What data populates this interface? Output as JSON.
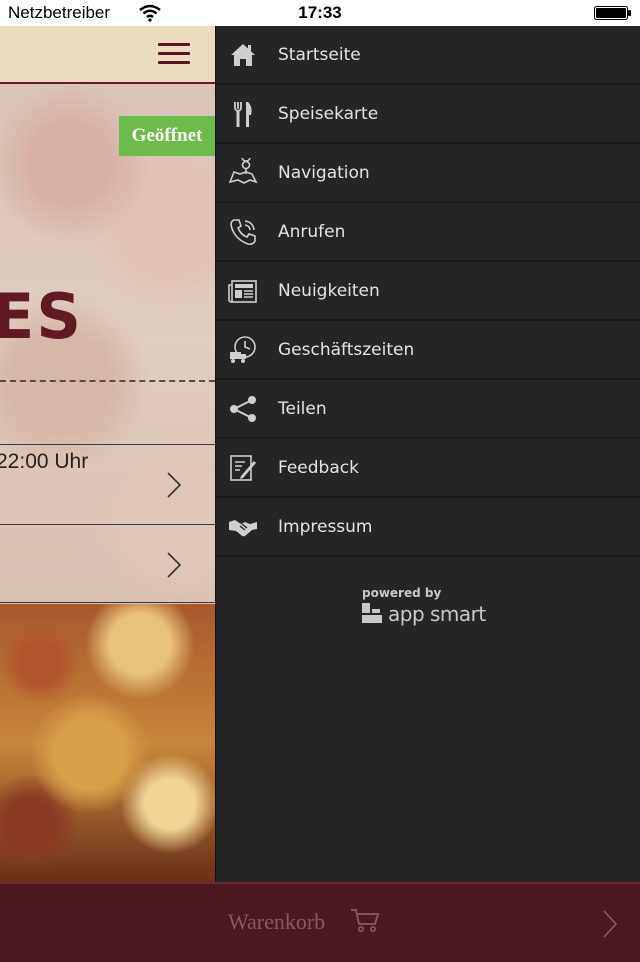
{
  "status_bar": {
    "carrier": "Netzbetreiber",
    "time": "17:33"
  },
  "main": {
    "open_badge": "Geöffnet",
    "title_fragment": "ES",
    "hours_fragment": "22:00 Uhr"
  },
  "drawer": {
    "items": [
      {
        "label": "Startseite",
        "icon": "home-icon"
      },
      {
        "label": "Speisekarte",
        "icon": "cutlery-icon"
      },
      {
        "label": "Navigation",
        "icon": "map-pin-icon"
      },
      {
        "label": "Anrufen",
        "icon": "phone-icon"
      },
      {
        "label": "Neuigkeiten",
        "icon": "newspaper-icon"
      },
      {
        "label": "Geschäftszeiten",
        "icon": "clock-truck-icon"
      },
      {
        "label": "Teilen",
        "icon": "share-icon"
      },
      {
        "label": "Feedback",
        "icon": "feedback-icon"
      },
      {
        "label": "Impressum",
        "icon": "handshake-icon"
      }
    ],
    "powered_by": "powered by",
    "brand": "app smart"
  },
  "cart": {
    "label": "Warenkorb"
  },
  "colors": {
    "drawer_bg": "#252525",
    "cart_bar": "#4d1720",
    "open_badge": "#6dbb4b",
    "header_bg": "#e9dcc0"
  }
}
